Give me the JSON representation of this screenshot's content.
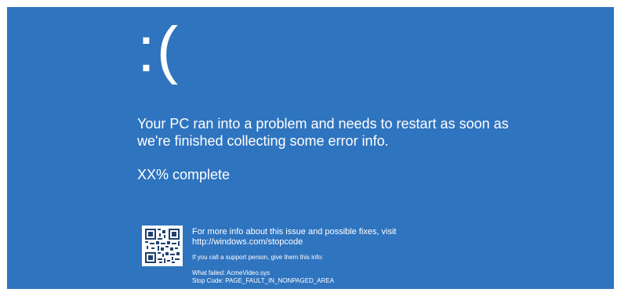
{
  "screen": {
    "sad_face": ":(",
    "message_line_1": "Your PC ran into a problem and needs to restart as soon as",
    "message_line_2": "we're finished collecting some error info.",
    "progress": "XX% complete",
    "qr_icon": "qr-code",
    "info_line": "For more info about this issue and possible fixes, visit",
    "info_link": "http://windows.com/stopcode",
    "support_note": "If you call a support person, give them this info:",
    "what_failed": "What failed: AcmeVideo.sys",
    "stop_code": "Stop Code: PAGE_FAULT_IN_NONPAGED_AREA",
    "background_color": "#2f74bf"
  }
}
